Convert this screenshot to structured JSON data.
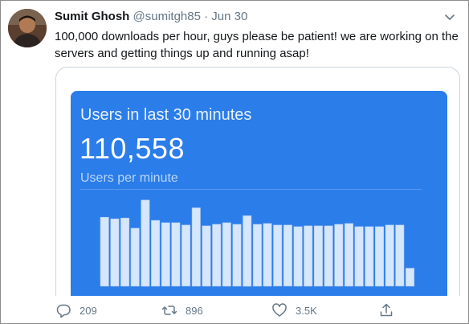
{
  "tweet": {
    "author_name": "Sumit Ghosh",
    "handle": "@sumitgh85",
    "separator": "·",
    "date": "Jun 30",
    "text": "100,000 downloads per hour, guys please be patient! we are working on the servers and getting things up and running asap!"
  },
  "card": {
    "title": "Users in last 30 minutes",
    "count": "110,558",
    "subtitle": "Users per minute"
  },
  "chart_data": {
    "type": "bar",
    "series": [
      {
        "values": [
          88,
          86,
          87,
          74,
          110,
          84,
          81,
          81,
          78,
          100,
          77,
          79,
          81,
          79,
          90,
          79,
          80,
          78,
          78,
          76,
          77,
          77,
          77,
          79,
          80,
          76,
          76,
          76,
          78,
          78,
          23
        ]
      }
    ],
    "ylim": [
      0,
      120
    ],
    "colors": {
      "bar": "#d6e6fb",
      "bar_outline": "#a9c8f3",
      "background": "#2b7de9"
    }
  },
  "actions": {
    "reply_count": "209",
    "retweet_count": "896",
    "like_count": "3.5K"
  },
  "icons": [
    "chevron-down-icon",
    "reply-icon",
    "retweet-icon",
    "like-icon",
    "share-icon"
  ]
}
